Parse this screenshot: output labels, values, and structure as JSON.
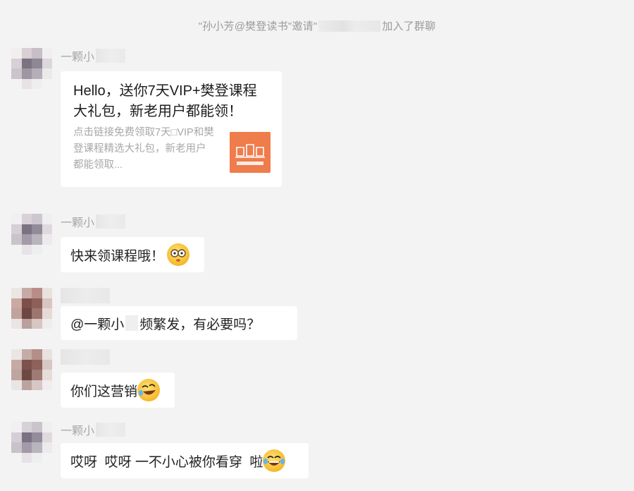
{
  "system_notice": {
    "prefix": "\"孙小芳@樊登读书\"邀请\"",
    "suffix": "加入了群聊"
  },
  "messages": [
    {
      "sender": "一颗小",
      "card": {
        "title": "Hello，送你7天VIP+樊登课程大礼包，新老用户都能领！",
        "description": "点击链接免费领取7天□VIP和樊登课程精选大礼包，新老用户都能领取..."
      }
    },
    {
      "sender": "一颗小",
      "text": "快来领课程哦！",
      "emoji": "thinking-face-emoji"
    },
    {
      "sender": "",
      "text_prefix": "@一颗小",
      "text_suffix": "频繁发，有必要吗？"
    },
    {
      "sender": "",
      "text": "你们这营销",
      "emoji": "rofl-emoji"
    },
    {
      "sender": "一颗小",
      "text": "哎呀  哎呀 一不小心被你看穿  啦",
      "emoji": "laughing-tears-emoji"
    }
  ],
  "colors": {
    "background": "#f3f3f3",
    "bubble": "#ffffff",
    "card_thumb": "#ef7c4b",
    "muted_text": "#a6a6a6"
  }
}
